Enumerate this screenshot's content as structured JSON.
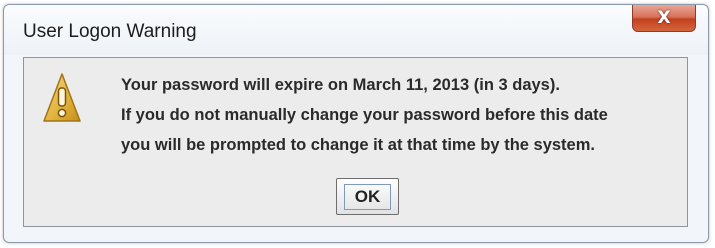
{
  "window": {
    "title": "User Logon Warning",
    "close_glyph": "X"
  },
  "dialog": {
    "icon": "warning-icon",
    "message_lines": [
      "Your password will expire on March 11, 2013 (in 3 days).",
      "If you do not manually change your password before this date",
      "you will be prompted to change it at that time by the system."
    ],
    "ok_label": "OK"
  },
  "colors": {
    "close_button": "#c4401f",
    "warning_icon": "#e0b13c"
  }
}
